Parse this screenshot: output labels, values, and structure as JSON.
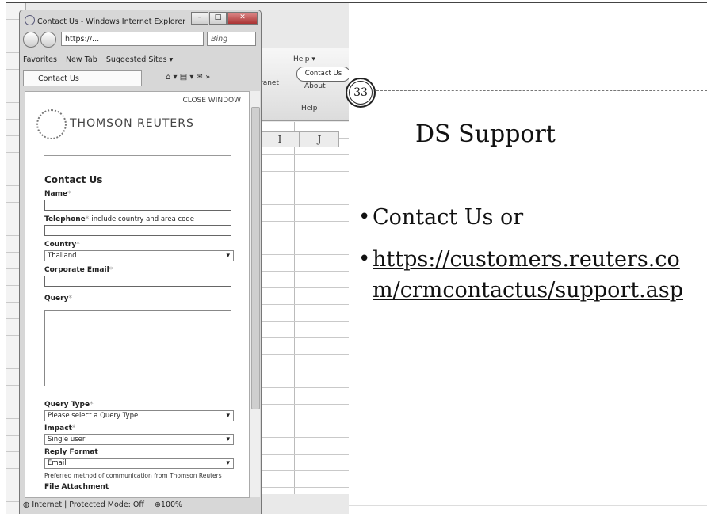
{
  "slide": {
    "page_number": "33",
    "title": "DS Support",
    "bullets": [
      "Contact Us or",
      "https://customers.reuters.com/crmcontactus/support.asp"
    ]
  },
  "excel": {
    "columns": [
      "I",
      "J"
    ],
    "help_label": "Help ▾",
    "contact_us_label": "Contact Us",
    "about_label": "About",
    "help_group_label": "Help",
    "ranet_label": "ranet"
  },
  "browser": {
    "window_title": "Contact Us - Windows Internet Explorer",
    "address": "https://...",
    "search_placeholder": "Bing",
    "favorites_label": "Favorites",
    "new_tab_label": "New Tab",
    "suggested_sites_label": "Suggested Sites ▾",
    "tab_label": "Contact Us",
    "status_text": "Internet | Protected Mode: Off",
    "zoom": "100%"
  },
  "page": {
    "close_window": "CLOSE WINDOW",
    "brand": "THOMSON REUTERS",
    "form_title": "Contact Us",
    "name_label": "Name",
    "telephone_label": "Telephone",
    "telephone_note": "include country and area code",
    "country_label": "Country",
    "country_value": "Thailand",
    "email_label": "Corporate Email",
    "query_label": "Query",
    "query_type_label": "Query Type",
    "query_type_value": "Please select a Query Type",
    "impact_label": "Impact",
    "impact_value": "Single user",
    "reply_format_label": "Reply Format",
    "reply_format_value": "Email",
    "preferred_note": "Preferred method of communication from Thomson Reuters",
    "file_attachment_label": "File Attachment"
  }
}
